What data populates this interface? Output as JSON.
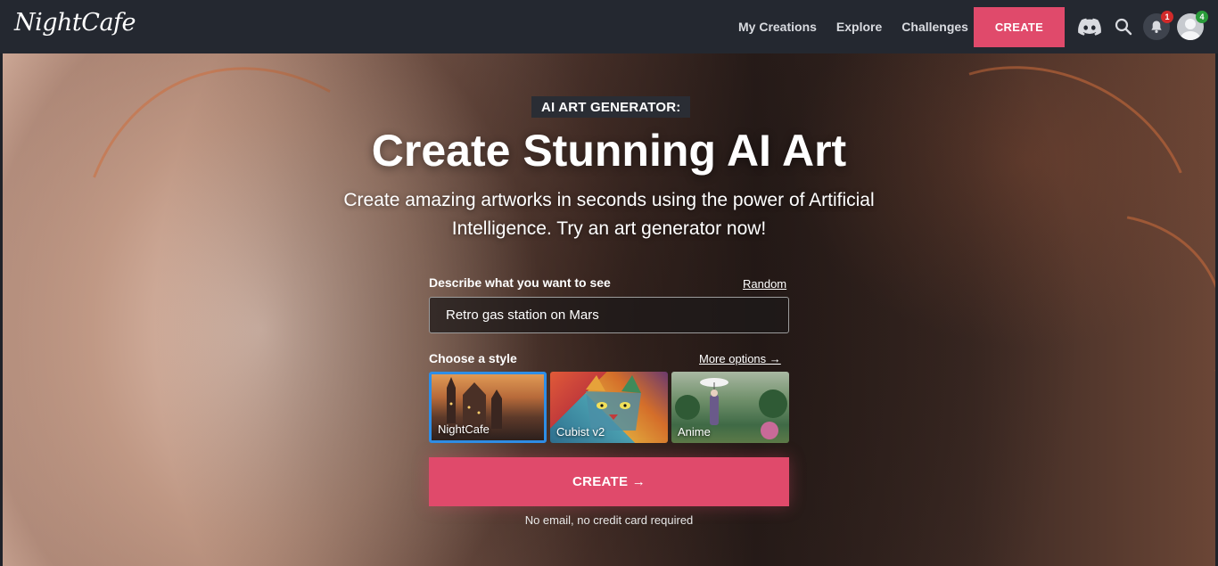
{
  "nav": {
    "logo": "NightCafe",
    "links": [
      "My Creations",
      "Explore",
      "Challenges"
    ],
    "create_label": "CREATE",
    "notification_count": "1",
    "profile_count": "4",
    "icons": [
      "discord-icon",
      "search-icon",
      "bell-icon",
      "avatar"
    ]
  },
  "hero": {
    "eyebrow": "AI ART GENERATOR:",
    "title": "Create Stunning AI Art",
    "subtitle": "Create amazing artworks in seconds using the power of Artificial Intelligence. Try an art generator now!"
  },
  "form": {
    "prompt_label": "Describe what you want to see",
    "random_link": "Random",
    "prompt_value": "Retro gas station on Mars",
    "style_label": "Choose a style",
    "more_options": "More options →",
    "styles": [
      {
        "label": "NightCafe",
        "selected": true
      },
      {
        "label": "Cubist v2",
        "selected": false
      },
      {
        "label": "Anime",
        "selected": false
      }
    ],
    "create_label": "CREATE →",
    "footnote": "No email, no credit card required"
  },
  "colors": {
    "accent": "#e04a6b",
    "nav_bg": "#242830",
    "selected_border": "#2e8ee6"
  }
}
